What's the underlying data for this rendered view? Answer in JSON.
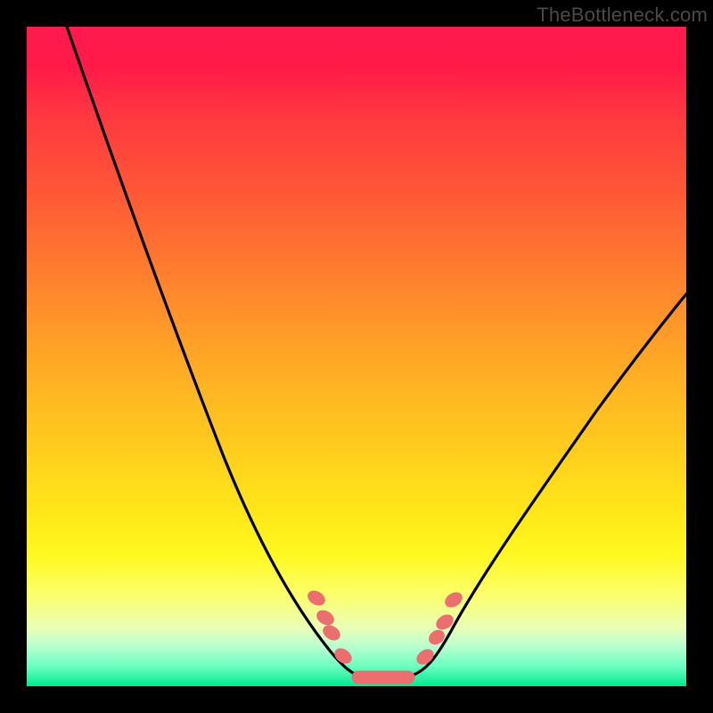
{
  "watermark": "TheBottleneck.com",
  "chart_data": {
    "type": "line",
    "title": "",
    "xlabel": "",
    "ylabel": "",
    "xlim": [
      0,
      100
    ],
    "ylim": [
      0,
      100
    ],
    "grid": false,
    "background": {
      "type": "vertical-gradient",
      "stops": [
        {
          "pos": 0,
          "color": "#ff1a50"
        },
        {
          "pos": 50,
          "color": "#ffb020"
        },
        {
          "pos": 80,
          "color": "#fff820"
        },
        {
          "pos": 100,
          "color": "#00e890"
        }
      ]
    },
    "series": [
      {
        "name": "curve",
        "color": "#000000",
        "x": [
          6,
          10,
          15,
          20,
          25,
          30,
          35,
          40,
          44,
          48,
          50,
          52,
          55,
          58,
          60,
          65,
          70,
          75,
          80,
          85,
          90,
          95,
          100
        ],
        "y": [
          100,
          90,
          78,
          66,
          54,
          43,
          33,
          23,
          14,
          8,
          5,
          4,
          3.5,
          4,
          6,
          10,
          17,
          24,
          32,
          40,
          48,
          55,
          60
        ]
      },
      {
        "name": "markers",
        "type": "scatter",
        "color": "#eb6f6f",
        "x": [
          44,
          45,
          46,
          49,
          50,
          53,
          56,
          57,
          60,
          61,
          62
        ],
        "y": [
          13,
          10,
          9,
          5,
          4,
          3.5,
          3.5,
          3.5,
          5,
          8,
          12
        ]
      }
    ],
    "annotations": []
  }
}
